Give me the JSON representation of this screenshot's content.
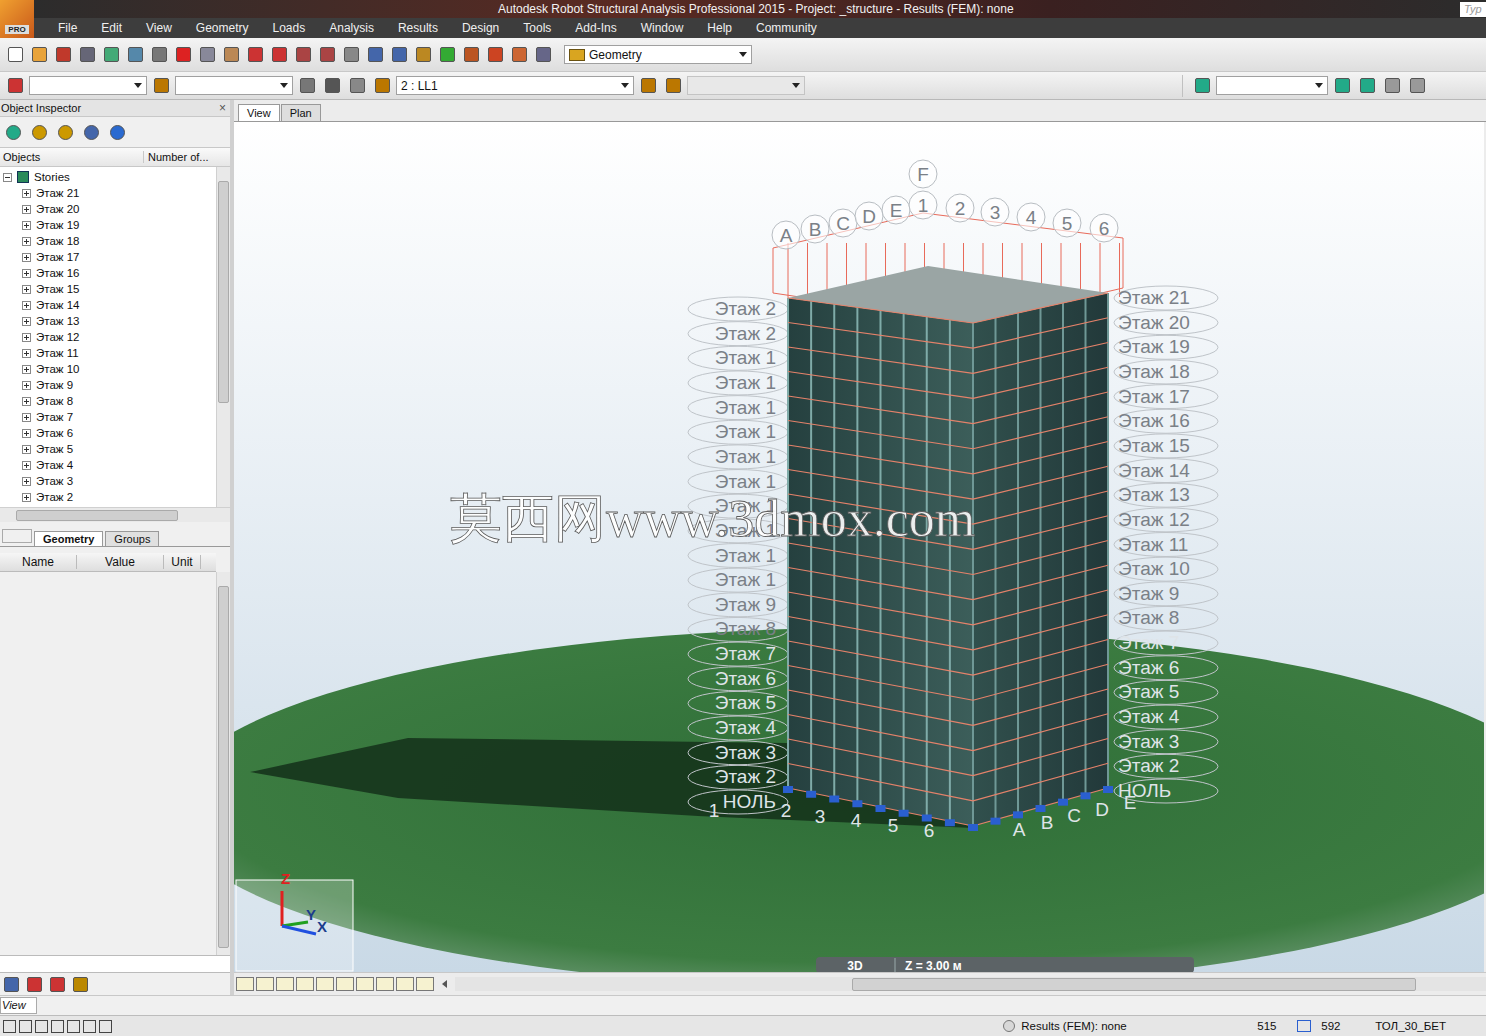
{
  "window": {
    "title": "Autodesk Robot Structural Analysis Professional 2015 - Project: _structure - Results (FEM): none",
    "logo": "PRO",
    "search_hint": "Typ"
  },
  "menu": [
    "File",
    "Edit",
    "View",
    "Geometry",
    "Loads",
    "Analysis",
    "Results",
    "Design",
    "Tools",
    "Add-Ins",
    "Window",
    "Help",
    "Community"
  ],
  "toolbar": {
    "layout": "Geometry",
    "load_case": "2 : LL1"
  },
  "inspector": {
    "title": "Object Inspector",
    "close": "×",
    "columns": [
      "Objects",
      "Number of..."
    ],
    "root": {
      "label": "Stories",
      "expanded": true
    },
    "items": [
      {
        "label": "Этаж 21",
        "expanded": false
      },
      {
        "label": "Этаж 20",
        "expanded": false
      },
      {
        "label": "Этаж 19",
        "expanded": false
      },
      {
        "label": "Этаж 18",
        "expanded": false
      },
      {
        "label": "Этаж 17",
        "expanded": false
      },
      {
        "label": "Этаж 16",
        "expanded": false
      },
      {
        "label": "Этаж 15",
        "expanded": false
      },
      {
        "label": "Этаж 14",
        "expanded": false
      },
      {
        "label": "Этаж 13",
        "expanded": false
      },
      {
        "label": "Этаж 12",
        "expanded": false
      },
      {
        "label": "Этаж 11",
        "expanded": false
      },
      {
        "label": "Этаж 10",
        "expanded": false
      },
      {
        "label": "Этаж 9",
        "expanded": false
      },
      {
        "label": "Этаж 8",
        "expanded": false
      },
      {
        "label": "Этаж 7",
        "expanded": false
      },
      {
        "label": "Этаж 6",
        "expanded": false
      },
      {
        "label": "Этаж 5",
        "expanded": false
      },
      {
        "label": "Этаж 4",
        "expanded": false
      },
      {
        "label": "Этаж 3",
        "expanded": false
      },
      {
        "label": "Этаж 2",
        "expanded": false
      }
    ],
    "tabs": [
      {
        "label": "Geometry",
        "selected": true
      },
      {
        "label": "Groups",
        "selected": false
      }
    ],
    "properties_columns": [
      "Name",
      "Value",
      "Unit"
    ]
  },
  "view_tabs": [
    {
      "label": "View",
      "selected": true
    },
    {
      "label": "Plan",
      "selected": false
    }
  ],
  "viewport": {
    "grid_top": [
      "A",
      "B",
      "C",
      "D",
      "E",
      "1",
      "2",
      "3",
      "4",
      "5",
      "6",
      "F"
    ],
    "stories_right": [
      "Этаж 21",
      "Этаж 20",
      "Этаж 19",
      "Этаж 18",
      "Этаж 17",
      "Этаж 16",
      "Этаж 15",
      "Этаж 14",
      "Этаж 13",
      "Этаж 12",
      "Этаж 11",
      "Этаж 10",
      "Этаж 9",
      "Этаж 8",
      "Этаж 7",
      "Этаж 6",
      "Этаж 5",
      "Этаж 4",
      "Этаж 3",
      "Этаж 2",
      "НОЛЬ"
    ],
    "stories_left": [
      "Этаж 2",
      "Этаж 2",
      "Этаж 1",
      "Этаж 1",
      "Этаж 1",
      "Этаж 1",
      "Этаж 1",
      "Этаж 1",
      "Этаж 1",
      "Этаж 1",
      "Этаж 1",
      "Этаж 1",
      "Этаж 9",
      "Этаж 8",
      "Этаж 7",
      "Этаж 6",
      "Этаж 5",
      "Этаж 4",
      "Этаж 3",
      "Этаж 2",
      "НОЛЬ"
    ],
    "grid_bottom": [
      "1",
      "2",
      "3",
      "4",
      "5",
      "6",
      "A",
      "B",
      "C",
      "D",
      "E"
    ],
    "watermark": "莫西网www.3dmox.com",
    "axes": [
      "Z",
      "Y",
      "X"
    ],
    "view_mode": "3D",
    "level": "Z = 3.00 м"
  },
  "command_line": "View",
  "status_bar": {
    "results": "Results (FEM): none",
    "nodes": "515",
    "bars": "592",
    "material": "ТОЛ_30_БЕТ"
  }
}
